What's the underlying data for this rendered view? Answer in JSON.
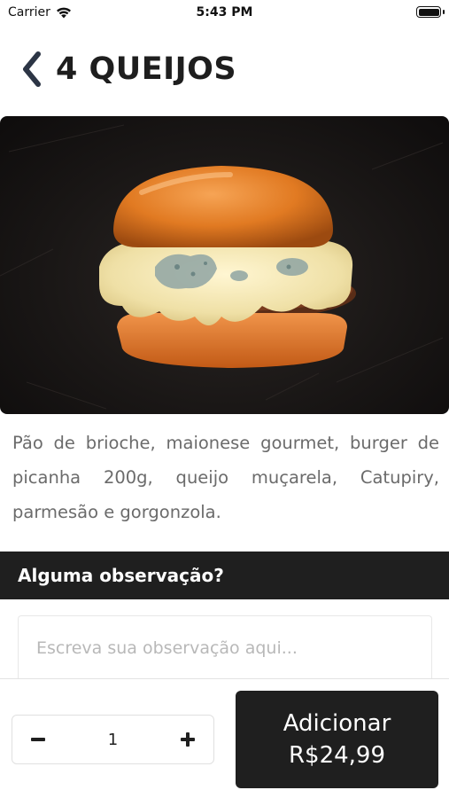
{
  "status_bar": {
    "carrier": "Carrier",
    "time": "5:43 PM"
  },
  "header": {
    "title": "4 QUEIJOS",
    "back_icon": "chevron-left-icon"
  },
  "product": {
    "image": "burger-photo",
    "description": "Pão de brioche, maionese gourmet, burger de picanha 200g, queijo muçarela, Catupiry, parmesão e gorgonzola."
  },
  "observation": {
    "title": "Alguma observação?",
    "placeholder": "Escreva sua observação aqui..."
  },
  "quantity": {
    "value": "1",
    "minus_icon": "minus-icon",
    "plus_icon": "plus-icon"
  },
  "add_button": {
    "label": "Adicionar",
    "price": "R$24,99"
  },
  "colors": {
    "dark": "#1f1f1f",
    "text_muted": "#6b6b6b",
    "placeholder": "#b8b8b8"
  }
}
